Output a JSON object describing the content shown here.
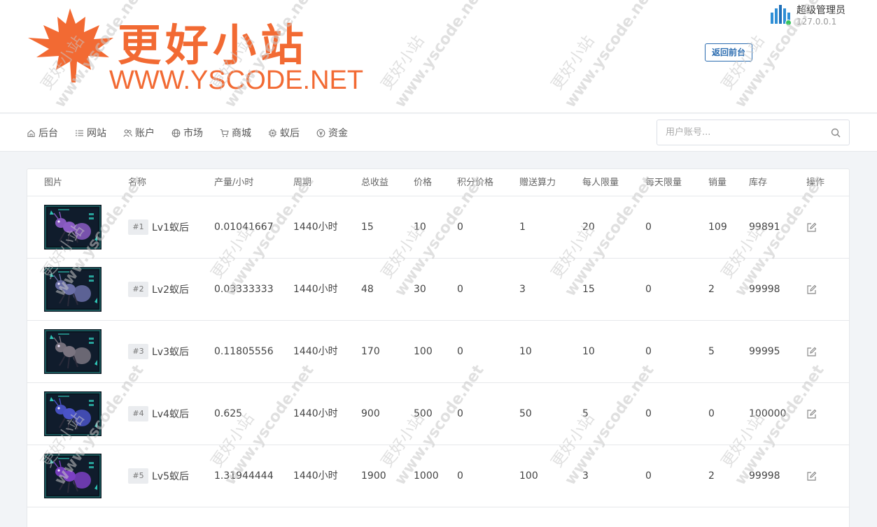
{
  "header": {
    "logo_cn": "更好小站",
    "logo_en": "WWW.YSCODE.NET",
    "user_name": "超级管理员",
    "user_ip": "127.0.0.1",
    "back_button": "返回前台",
    "status_color": "#35c35a",
    "brand_color": "#f26a33"
  },
  "nav": {
    "items": [
      {
        "label": "后台",
        "icon": "home-icon"
      },
      {
        "label": "网站",
        "icon": "list-icon"
      },
      {
        "label": "账户",
        "icon": "users-icon"
      },
      {
        "label": "市场",
        "icon": "globe-icon"
      },
      {
        "label": "商城",
        "icon": "cart-icon"
      },
      {
        "label": "蚁后",
        "icon": "chip-icon"
      },
      {
        "label": "资金",
        "icon": "coin-icon"
      }
    ],
    "search_placeholder": "用户账号..."
  },
  "table": {
    "columns": [
      "图片",
      "名称",
      "产量/小时",
      "周期",
      "总收益",
      "价格",
      "积分价格",
      "赠送算力",
      "每人限量",
      "每天限量",
      "销量",
      "库存",
      "操作"
    ],
    "rows": [
      {
        "id": "#1",
        "name": "Lv1蚁后",
        "output": "0.01041667",
        "period": "1440小时",
        "total": "15",
        "price": "10",
        "points_price": "0",
        "bonus_power": "1",
        "per_user_limit": "20",
        "daily_limit": "0",
        "sales": "109",
        "stock": "99891",
        "ant_color": "#8b5cc4",
        "deco_color": "#2ec4b6"
      },
      {
        "id": "#2",
        "name": "Lv2蚁后",
        "output": "0.03333333",
        "period": "1440小时",
        "total": "48",
        "price": "30",
        "points_price": "0",
        "bonus_power": "3",
        "per_user_limit": "15",
        "daily_limit": "0",
        "sales": "2",
        "stock": "99998",
        "ant_color": "#6a6fa8",
        "deco_color": "#2ec4b6"
      },
      {
        "id": "#3",
        "name": "Lv3蚁后",
        "output": "0.11805556",
        "period": "1440小时",
        "total": "170",
        "price": "100",
        "points_price": "0",
        "bonus_power": "10",
        "per_user_limit": "10",
        "daily_limit": "0",
        "sales": "5",
        "stock": "99995",
        "ant_color": "#7a7480",
        "deco_color": "#2ec4b6"
      },
      {
        "id": "#4",
        "name": "Lv4蚁后",
        "output": "0.625",
        "period": "1440小时",
        "total": "900",
        "price": "500",
        "points_price": "0",
        "bonus_power": "50",
        "per_user_limit": "5",
        "daily_limit": "0",
        "sales": "0",
        "stock": "100000",
        "ant_color": "#4a53c8",
        "deco_color": "#2ec4b6"
      },
      {
        "id": "#5",
        "name": "Lv5蚁后",
        "output": "1.31944444",
        "period": "1440小时",
        "total": "1900",
        "price": "1000",
        "points_price": "0",
        "bonus_power": "100",
        "per_user_limit": "3",
        "daily_limit": "0",
        "sales": "2",
        "stock": "99998",
        "ant_color": "#7b3fc4",
        "deco_color": "#2ec4b6"
      }
    ]
  },
  "watermark": {
    "cn": "更好小站",
    "en": "www.yscode.net"
  }
}
